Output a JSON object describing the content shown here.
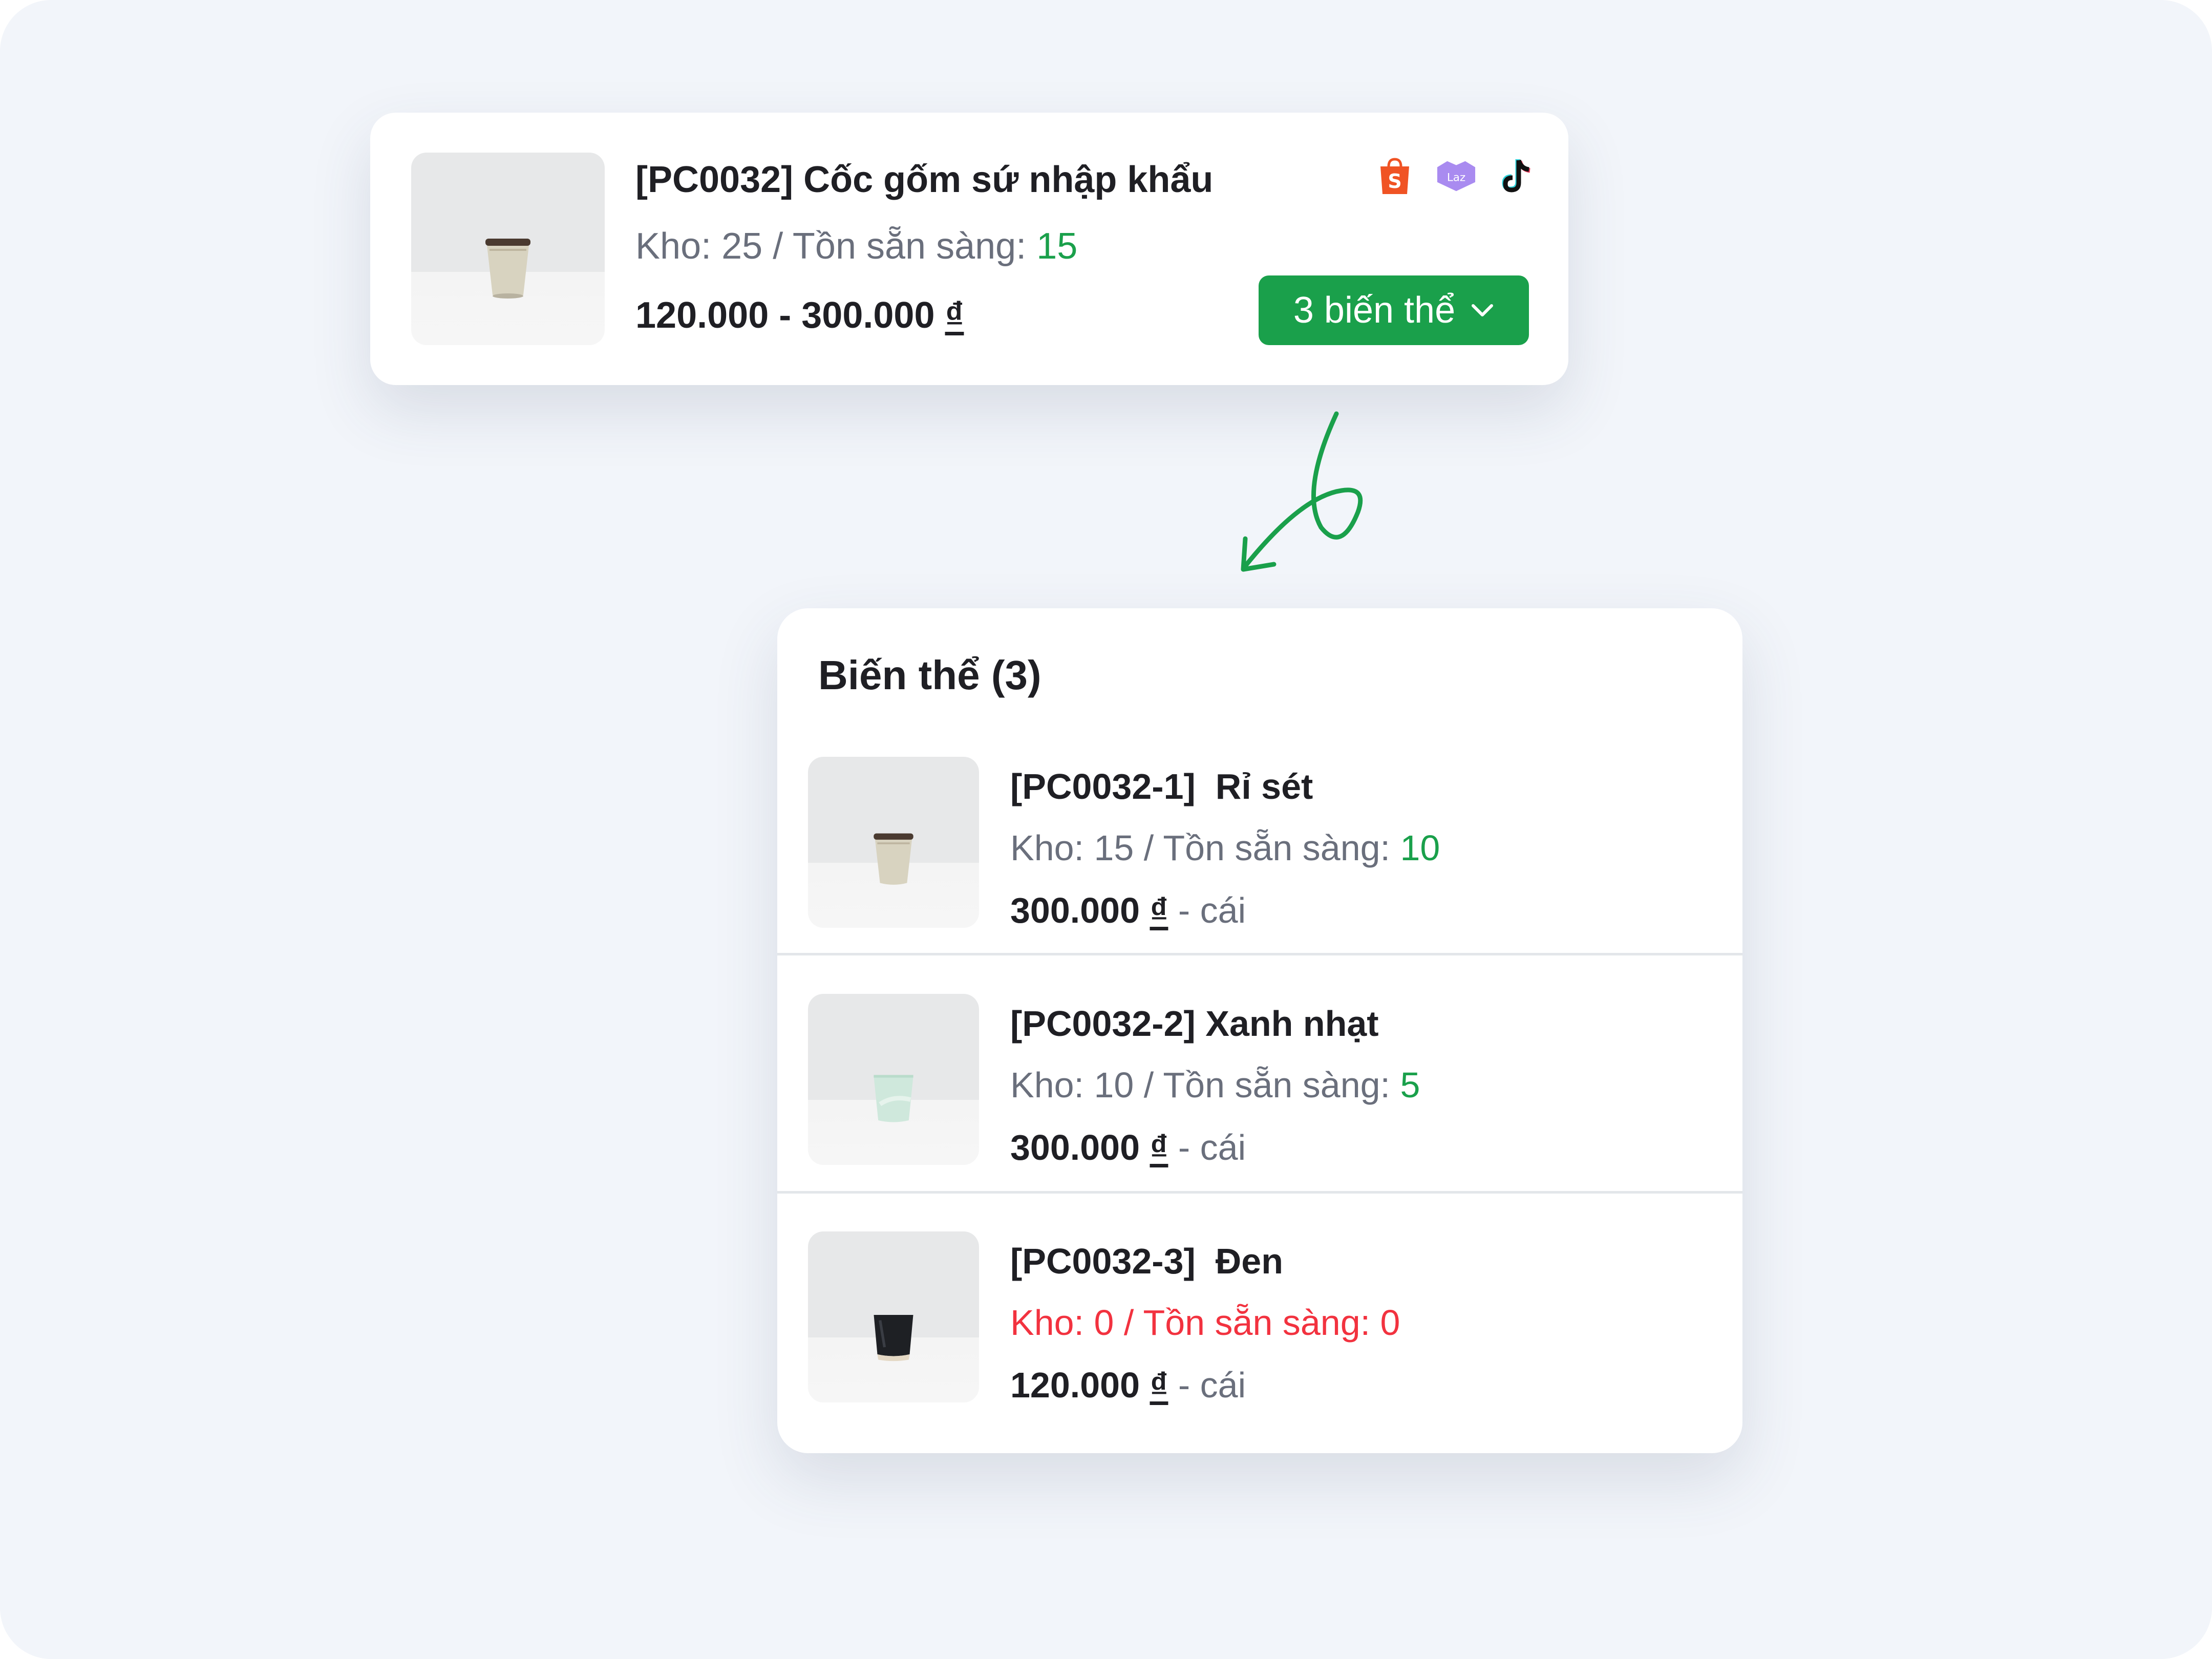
{
  "product": {
    "title": "[PC0032] Cốc gốm sứ nhập khẩu",
    "stock_prefix": "Kho: 25 / Tồn sẵn sàng:",
    "stock_ready": "15",
    "price_range": "120.000 - 300.000",
    "currency": "₫",
    "variants_button": "3 biến thể",
    "channels": [
      {
        "name": "shopee",
        "icon": "shopee-icon",
        "glyph": "S"
      },
      {
        "name": "lazada",
        "icon": "lazada-icon",
        "glyph": "Laz"
      },
      {
        "name": "tiktok",
        "icon": "tiktok-icon",
        "glyph": "♪"
      }
    ]
  },
  "variants_panel": {
    "title": "Biến thể (3)",
    "items": [
      {
        "name": "[PC0032-1]  Rỉ sét",
        "stock_prefix": "Kho: 15 / Tồn sẵn sàng: ",
        "stock_ready": "10",
        "price": "300.000",
        "currency": "₫",
        "unit": " - cái",
        "cup_color": "#d8d3c0"
      },
      {
        "name": "[PC0032-2] Xanh nhạt",
        "stock_prefix": "Kho: 10 / Tồn sẵn sàng: ",
        "stock_ready": "5",
        "price": "300.000",
        "currency": "₫",
        "unit": " - cái",
        "cup_color": "#cfe8dc"
      },
      {
        "name": "[PC0032-3]  Đen",
        "stock_prefix": "Kho: 0 / Tồn sẵn sàng: ",
        "stock_ready": "0",
        "price": "120.000",
        "currency": "₫",
        "unit": " - cái",
        "cup_color": "#1e2024"
      }
    ]
  },
  "colors": {
    "accent_green": "#1aa04b",
    "out_of_stock_red": "#f2323f",
    "muted_text": "#6a6f7c",
    "background": "#f2f5fa"
  }
}
